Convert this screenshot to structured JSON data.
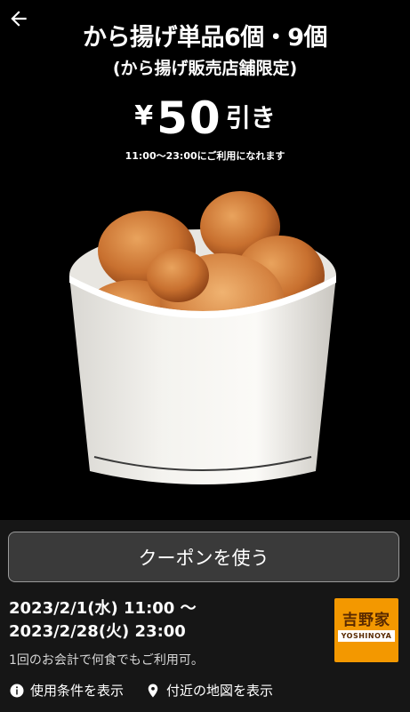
{
  "header": {
    "title_line1": "から揚げ単品6個・9個",
    "title_line2": "(から揚げ販売店舗限定)",
    "price_currency": "¥",
    "price_amount": "50",
    "price_suffix": "引き",
    "hours": "11:00〜23:00にご利用になれます"
  },
  "coupon": {
    "use_button_label": "クーポンを使う",
    "period_line1": "2023/2/1(水) 11:00 〜",
    "period_line2": "2023/2/28(火) 23:00",
    "note": "1回のお会計で何食でもご利用可。"
  },
  "brand": {
    "logo_text": "吉野家",
    "logo_band": "YOSHINOYA",
    "color": "#f39800"
  },
  "links": {
    "terms_label": "使用条件を表示",
    "map_label": "付近の地図を表示",
    "terms_icon": "info-icon",
    "map_icon": "location-pin-icon"
  },
  "icons": {
    "back": "back-arrow-icon"
  }
}
